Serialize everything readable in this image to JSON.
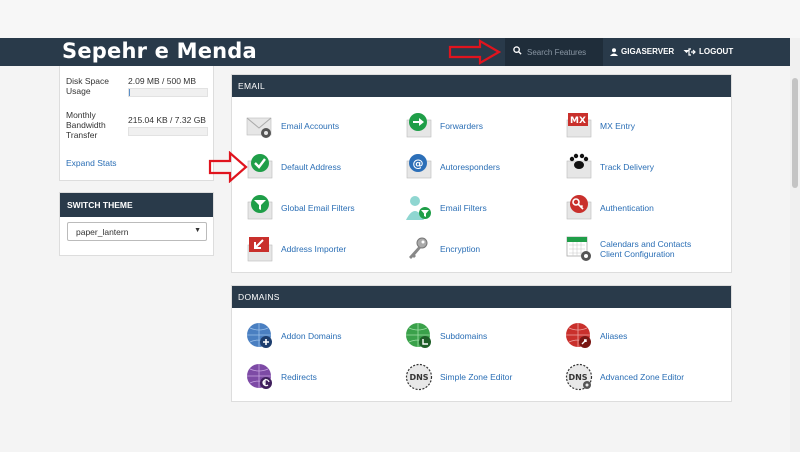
{
  "header": {
    "brand": "Sepehr e Menda",
    "search_placeholder": "Search Features",
    "user_label": "GIGASERVER",
    "logout_label": "LOGOUT"
  },
  "stats": {
    "disk": {
      "label": "Disk Space Usage",
      "value": "2.09 MB / 500 MB",
      "fraction": 0.004
    },
    "bandwidth": {
      "label": "Monthly Bandwidth Transfer",
      "value": "215.04 KB / 7.32 GB",
      "fraction": 0.0
    },
    "expand_label": "Expand Stats"
  },
  "theme": {
    "title": "SWITCH THEME",
    "selected": "paper_lantern"
  },
  "email": {
    "title": "EMAIL",
    "items": [
      {
        "label": "Email Accounts",
        "icon": "email-accounts-icon"
      },
      {
        "label": "Forwarders",
        "icon": "forwarders-icon"
      },
      {
        "label": "MX Entry",
        "icon": "mx-entry-icon"
      },
      {
        "label": "Default Address",
        "icon": "default-address-icon"
      },
      {
        "label": "Autoresponders",
        "icon": "autoresponders-icon"
      },
      {
        "label": "Track Delivery",
        "icon": "track-delivery-icon"
      },
      {
        "label": "Global Email Filters",
        "icon": "global-email-filters-icon"
      },
      {
        "label": "Email Filters",
        "icon": "email-filters-icon"
      },
      {
        "label": "Authentication",
        "icon": "authentication-icon"
      },
      {
        "label": "Address Importer",
        "icon": "address-importer-icon"
      },
      {
        "label": "Encryption",
        "icon": "encryption-icon"
      },
      {
        "label": "Calendars and Contacts Client Configuration",
        "icon": "calendars-contacts-icon"
      }
    ]
  },
  "domains": {
    "title": "DOMAINS",
    "items": [
      {
        "label": "Addon Domains",
        "icon": "addon-domains-icon"
      },
      {
        "label": "Subdomains",
        "icon": "subdomains-icon"
      },
      {
        "label": "Aliases",
        "icon": "aliases-icon"
      },
      {
        "label": "Redirects",
        "icon": "redirects-icon"
      },
      {
        "label": "Simple Zone Editor",
        "icon": "simple-zone-editor-icon"
      },
      {
        "label": "Advanced Zone Editor",
        "icon": "advanced-zone-editor-icon"
      }
    ]
  },
  "icon_text": {
    "mx": "MX",
    "dns": "DNS"
  },
  "colors": {
    "navbar": "#293a4a",
    "link": "#2a6eb5",
    "annotation_arrow": "#e0141e"
  }
}
